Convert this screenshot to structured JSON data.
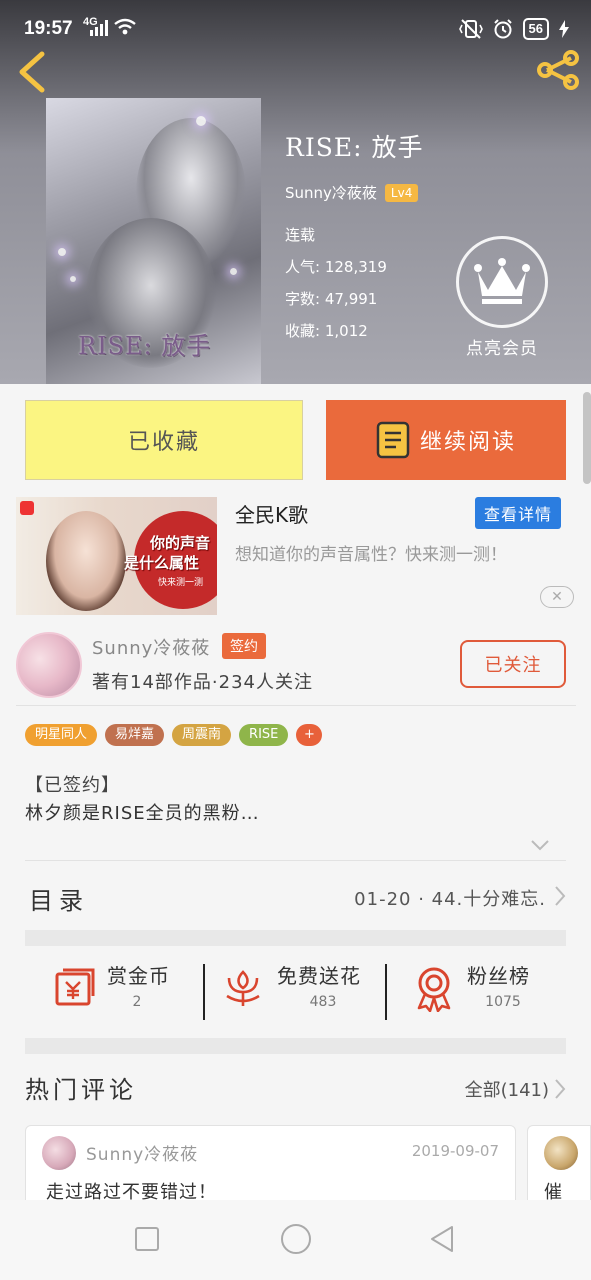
{
  "status_bar": {
    "time": "19:57",
    "network": "4G",
    "battery": "56"
  },
  "book": {
    "cover_title": "RISE: 放手",
    "title": "RISE: 放手",
    "author": "Sunny冷莜莜",
    "level": "Lv4",
    "status": "连载",
    "popularity_label": "人气:",
    "popularity": "128,319",
    "words_label": "字数:",
    "words": "47,991",
    "favorites_label": "收藏:",
    "favorites": "1,012",
    "vip_label": "点亮会员"
  },
  "buttons": {
    "collected": "已收藏",
    "continue_reading": "继续阅读"
  },
  "ad": {
    "image_text_line1": "你的声音",
    "image_text_line2": "是什么属性",
    "image_text_small": "快来测一测",
    "name": "全民K歌",
    "detail_button": "查看详情",
    "description": "想知道你的声音属性？快来测一测！"
  },
  "author_card": {
    "name": "Sunny冷莜莜",
    "sign_badge": "签约",
    "stats": "著有14部作品·234人关注",
    "follow_button": "已关注"
  },
  "tags": [
    {
      "label": "明星同人",
      "color": "#f0a030"
    },
    {
      "label": "易烊嘉",
      "color": "#c0714f"
    },
    {
      "label": "周震南",
      "color": "#d4a442"
    },
    {
      "label": "RISE",
      "color": "#8fb54a"
    },
    {
      "label": "+",
      "color": "#e8613a"
    }
  ],
  "summary": {
    "line1": "【已签约】",
    "line2": "林夕颜是RISE全员的黑粉…"
  },
  "toc": {
    "title": "目录",
    "latest": "01-20 · 44.十分难忘."
  },
  "actions": [
    {
      "label": "赏金币",
      "count": "2",
      "icon": "red-envelope-icon"
    },
    {
      "label": "免费送花",
      "count": "483",
      "icon": "flower-icon"
    },
    {
      "label": "粉丝榜",
      "count": "1075",
      "icon": "medal-icon"
    }
  ],
  "comments": {
    "title": "热门评论",
    "all_label": "全部(141)",
    "items": [
      {
        "user": "Sunny冷莜莜",
        "date": "2019-09-07",
        "text": "走过路过不要错过！"
      },
      {
        "user": "",
        "date": "",
        "text": "催"
      }
    ]
  },
  "colors": {
    "accent_orange": "#ea6a3c",
    "collected_yellow": "#fbf582",
    "detail_blue": "#2b7de0"
  }
}
